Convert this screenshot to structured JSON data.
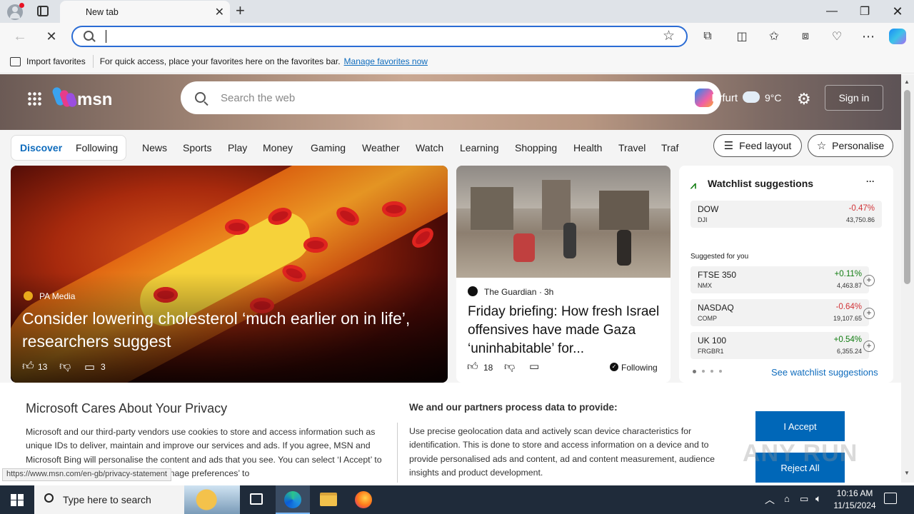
{
  "browser": {
    "tab_title": "New tab",
    "new_tab_symbol": "+",
    "address_value": "",
    "favbar_import": "Import favorites",
    "favbar_message": "For quick access, place your favorites here on the favorites bar.",
    "favbar_link": "Manage favorites now"
  },
  "msn": {
    "logo": "msn",
    "search_placeholder": "Search the web",
    "location": "Erfurt",
    "temperature": "9°C",
    "signin": "Sign in",
    "tabs": [
      "Discover",
      "Following"
    ],
    "nav": [
      "News",
      "Sports",
      "Play",
      "Money",
      "Gaming",
      "Weather",
      "Watch",
      "Learning",
      "Shopping",
      "Health",
      "Travel",
      "Traf"
    ],
    "feed_layout": "Feed layout",
    "personalise": "Personalise"
  },
  "card1": {
    "source": "PA Media",
    "headline": "Consider lowering cholesterol ‘much earlier on in life’, researchers suggest",
    "likes": "13",
    "comments": "3"
  },
  "card2": {
    "source": "The Guardian",
    "time": "3h",
    "headline": "Friday briefing: How fresh Israel offensives have made Gaza ‘uninhabitable’ for...",
    "likes": "18",
    "following": "Following"
  },
  "watchlist": {
    "title": "Watchlist suggestions",
    "more": "···",
    "suggested_label": "Suggested for you",
    "see_more": "See watchlist suggestions",
    "main": {
      "name": "DOW",
      "symbol": "DJI",
      "change": "-0.47%",
      "value": "43,750.86"
    },
    "stocks": [
      {
        "name": "FTSE 350",
        "symbol": "NMX",
        "change": "+0.11%",
        "value": "4,463.87"
      },
      {
        "name": "NASDAQ",
        "symbol": "COMP",
        "change": "-0.64%",
        "value": "19,107.65"
      },
      {
        "name": "UK 100",
        "symbol": "FRGBR1",
        "change": "+0.54%",
        "value": "6,355.24"
      }
    ]
  },
  "privacy": {
    "title": "Microsoft Cares About Your Privacy",
    "body": "Microsoft and our third-party vendors use cookies to store and access information such as unique IDs to deliver, maintain and improve our services and ads. If you agree, MSN and Microsoft Bing will personalise the content and ads that you see. You can select ‘I Accept’ to consent to these uses or click on ‘Manage preferences’ to",
    "partners_title": "We and our partners process data to provide:",
    "partners_body": "Use precise geolocation data and actively scan device characteristics for identification. This is done to store and access information on a device and to provide personalised ads and content, ad and content measurement, audience insights and product development.",
    "accept": "I Accept",
    "reject": "Reject All"
  },
  "status_url": "https://www.msn.com/en-gb/privacy-statement",
  "watermark": "ANY RUN",
  "taskbar": {
    "search_placeholder": "Type here to search",
    "time": "10:16 AM",
    "date": "11/15/2024"
  }
}
